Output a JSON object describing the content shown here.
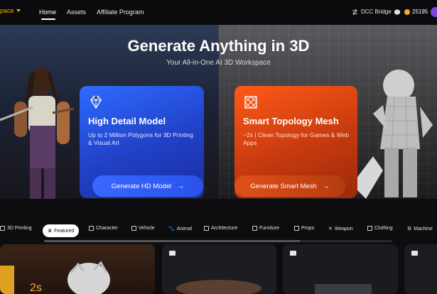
{
  "header": {
    "brand_partial": "pace",
    "nav": [
      {
        "label": "Home",
        "active": true
      },
      {
        "label": "Assets",
        "active": false
      },
      {
        "label": "Affiliate Program",
        "active": false
      }
    ],
    "dcc_label": "DCC Bridge",
    "credits": "25195"
  },
  "hero": {
    "title": "Generate Anything in 3D",
    "subtitle": "Your All-in-One AI 3D Workspace",
    "cards": [
      {
        "title": "High Detail Model",
        "description": "Up to 2 Million Polygons for 3D Printing & Visual Art",
        "button": "Generate HD Model",
        "icon": "diamond-icon",
        "accent": "#2a52ea"
      },
      {
        "title": "Smart Topology Mesh",
        "description": "~2s | Clean Topology for Games & Web Apps",
        "button": "Generate Smart Mesh",
        "icon": "mesh-icon",
        "accent": "#c73a0f"
      }
    ]
  },
  "categories": [
    {
      "label": "3D Printing",
      "icon": "printer-icon"
    },
    {
      "label": "Featured",
      "icon": "crown-icon",
      "selected": true
    },
    {
      "label": "Character",
      "icon": "person-icon"
    },
    {
      "label": "Vehicle",
      "icon": "car-icon"
    },
    {
      "label": "Animal",
      "icon": "paw-icon"
    },
    {
      "label": "Architecture",
      "icon": "building-icon"
    },
    {
      "label": "Furniture",
      "icon": "sofa-icon"
    },
    {
      "label": "Props",
      "icon": "props-icon"
    },
    {
      "label": "Weapon",
      "icon": "sword-icon"
    },
    {
      "label": "Clothing",
      "icon": "shirt-icon"
    },
    {
      "label": "Machine",
      "icon": "gear-icon"
    }
  ]
}
